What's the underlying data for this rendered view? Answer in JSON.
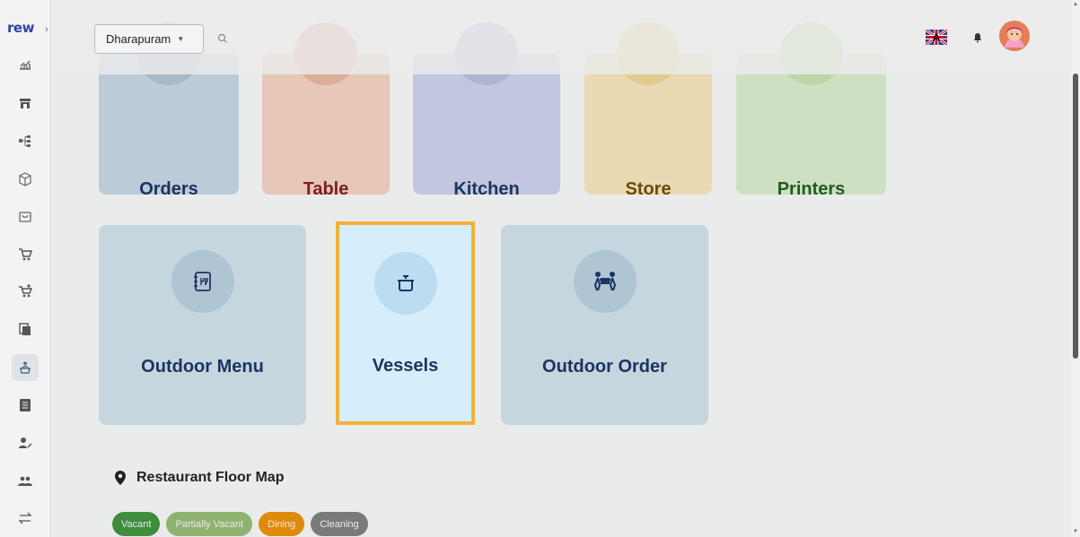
{
  "app": {
    "logo_text": "rew"
  },
  "topbar": {
    "branch": "Dharapuram",
    "search_icon": "search-icon",
    "flag_icon": "uk-flag-icon",
    "bell_icon": "bell-icon",
    "avatar_icon": "user-avatar"
  },
  "sidebar": {
    "items": [
      {
        "icon": "dashboard-chart-icon"
      },
      {
        "icon": "store-icon"
      },
      {
        "icon": "hierarchy-icon"
      },
      {
        "icon": "package-icon"
      },
      {
        "icon": "bag-icon"
      },
      {
        "icon": "cart-icon"
      },
      {
        "icon": "cart-add-icon"
      },
      {
        "icon": "copy-icon"
      },
      {
        "icon": "restaurant-icon",
        "active": true
      },
      {
        "icon": "ledger-icon"
      },
      {
        "icon": "user-edit-icon"
      },
      {
        "icon": "users-icon"
      },
      {
        "icon": "transfer-icon"
      }
    ]
  },
  "tiles_row1": [
    {
      "label": "Orders"
    },
    {
      "label": "Table"
    },
    {
      "label": "Kitchen"
    },
    {
      "label": "Store"
    },
    {
      "label": "Printers"
    }
  ],
  "tiles_row2": [
    {
      "label": "Outdoor Menu",
      "icon": "menu-book-icon"
    },
    {
      "label": "Vessels",
      "icon": "pot-icon",
      "highlighted": true
    },
    {
      "label": "Outdoor Order",
      "icon": "delivery-people-icon"
    }
  ],
  "floor_map": {
    "title": "Restaurant Floor Map",
    "chips": [
      {
        "label": "Vacant",
        "color": "#3f8d3c"
      },
      {
        "label": "Partially Vacant",
        "color": "#8fb271"
      },
      {
        "label": "Dining",
        "color": "#e08a0d"
      },
      {
        "label": "Cleaning",
        "color": "#7a7a7a"
      }
    ]
  }
}
